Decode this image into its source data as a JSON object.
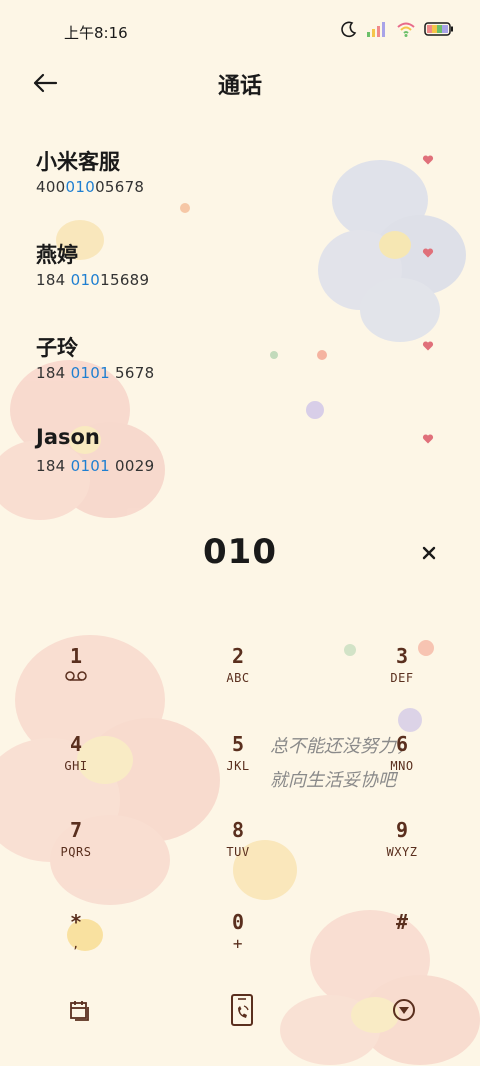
{
  "status_bar": {
    "time": "上午8:16"
  },
  "app_bar": {
    "title": "通话"
  },
  "contacts": [
    {
      "name": "小米客服",
      "number_pre": "400",
      "number_hl": "010",
      "number_post": "05678"
    },
    {
      "name": "燕婷",
      "number_pre": "184 ",
      "number_hl": "010",
      "number_post": "15689"
    },
    {
      "name": "子玲",
      "number_pre": "184 ",
      "number_hl": "0101",
      "number_post": " 5678"
    },
    {
      "name": "Jason",
      "number_pre": "184 ",
      "number_hl": "0101",
      "number_post": " 0029"
    }
  ],
  "dial_input": "010",
  "keypad": [
    {
      "digit": "1",
      "letters": ""
    },
    {
      "digit": "2",
      "letters": "ABC"
    },
    {
      "digit": "3",
      "letters": "DEF"
    },
    {
      "digit": "4",
      "letters": "GHI"
    },
    {
      "digit": "5",
      "letters": "JKL"
    },
    {
      "digit": "6",
      "letters": "MNO"
    },
    {
      "digit": "7",
      "letters": "PQRS"
    },
    {
      "digit": "8",
      "letters": "TUV"
    },
    {
      "digit": "9",
      "letters": "WXYZ"
    },
    {
      "digit": "*",
      "letters": ","
    },
    {
      "digit": "0",
      "letters": "+"
    },
    {
      "digit": "#",
      "letters": ""
    }
  ],
  "handwriting": {
    "line1": "总不能还没努力，",
    "line2": "就向生活妥协吧"
  },
  "icons": {
    "back": "arrow-left-icon",
    "voicemail": "voicemail-icon",
    "clear": "close-icon",
    "calendar": "calendar-icon",
    "dial": "phone-call-icon",
    "collapse": "collapse-keypad-icon",
    "favorite": "heart-icon"
  },
  "colors": {
    "background": "#fdf6e6",
    "highlight": "#1f7fd1",
    "key_text": "#5a2f1e",
    "heart": "#e0707a"
  }
}
